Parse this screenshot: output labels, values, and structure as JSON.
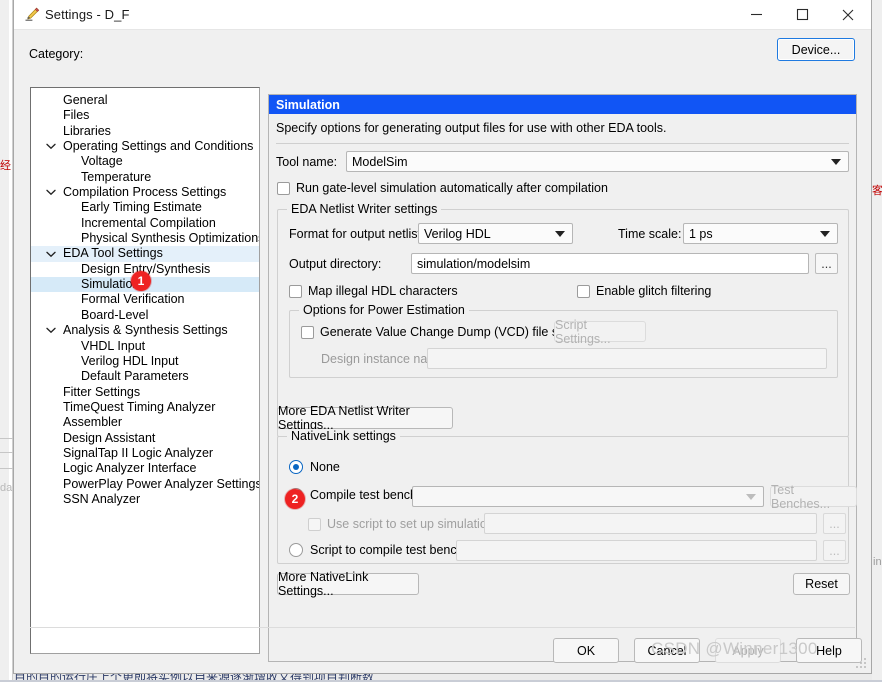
{
  "window": {
    "title": "Settings - D_F",
    "icon": "pencil-icon",
    "minimize": "minimize-icon",
    "maximize": "maximize-icon",
    "close": "close-icon"
  },
  "category": {
    "label": "Category:",
    "device_button": "Device...",
    "items": [
      {
        "label": "General",
        "level": 0,
        "expander": "none"
      },
      {
        "label": "Files",
        "level": 0,
        "expander": "none"
      },
      {
        "label": "Libraries",
        "level": 0,
        "expander": "none"
      },
      {
        "label": "Operating Settings and Conditions",
        "level": 0,
        "expander": "expanded"
      },
      {
        "label": "Voltage",
        "level": 1,
        "expander": "none"
      },
      {
        "label": "Temperature",
        "level": 1,
        "expander": "none"
      },
      {
        "label": "Compilation Process Settings",
        "level": 0,
        "expander": "expanded"
      },
      {
        "label": "Early Timing Estimate",
        "level": 1,
        "expander": "none"
      },
      {
        "label": "Incremental Compilation",
        "level": 1,
        "expander": "none"
      },
      {
        "label": "Physical Synthesis Optimizations",
        "level": 1,
        "expander": "none"
      },
      {
        "label": "EDA Tool Settings",
        "level": 0,
        "expander": "expanded",
        "state": "highlight"
      },
      {
        "label": "Design Entry/Synthesis",
        "level": 1,
        "expander": "none"
      },
      {
        "label": "Simulation",
        "level": 1,
        "expander": "none",
        "state": "selected"
      },
      {
        "label": "Formal Verification",
        "level": 1,
        "expander": "none"
      },
      {
        "label": "Board-Level",
        "level": 1,
        "expander": "none"
      },
      {
        "label": "Analysis & Synthesis Settings",
        "level": 0,
        "expander": "expanded"
      },
      {
        "label": "VHDL Input",
        "level": 1,
        "expander": "none"
      },
      {
        "label": "Verilog HDL Input",
        "level": 1,
        "expander": "none"
      },
      {
        "label": "Default Parameters",
        "level": 1,
        "expander": "none"
      },
      {
        "label": "Fitter Settings",
        "level": 0,
        "expander": "none"
      },
      {
        "label": "TimeQuest Timing Analyzer",
        "level": 0,
        "expander": "none"
      },
      {
        "label": "Assembler",
        "level": 0,
        "expander": "none"
      },
      {
        "label": "Design Assistant",
        "level": 0,
        "expander": "none"
      },
      {
        "label": "SignalTap II Logic Analyzer",
        "level": 0,
        "expander": "none"
      },
      {
        "label": "Logic Analyzer Interface",
        "level": 0,
        "expander": "none"
      },
      {
        "label": "PowerPlay Power Analyzer Settings",
        "level": 0,
        "expander": "none"
      },
      {
        "label": "SSN Analyzer",
        "level": 0,
        "expander": "none"
      }
    ]
  },
  "pane": {
    "header": "Simulation",
    "description": "Specify options for generating output files for use with other EDA tools.",
    "tool_name_label": "Tool name:",
    "tool_name_value": "ModelSim",
    "run_gate_level_label": "Run gate-level simulation automatically after compilation",
    "run_gate_level_checked": false
  },
  "netlist_writer": {
    "group_title": "EDA Netlist Writer settings",
    "format_label": "Format for output netlist:",
    "format_value": "Verilog HDL",
    "time_scale_label": "Time scale:",
    "time_scale_value": "1 ps",
    "output_dir_label": "Output directory:",
    "output_dir_value": "simulation/modelsim",
    "browse_label": "...",
    "map_illegal_label": "Map illegal HDL characters",
    "map_illegal_checked": false,
    "glitch_label": "Enable glitch filtering",
    "glitch_checked": false,
    "power_group_title": "Options for Power Estimation",
    "vcd_label": "Generate Value Change Dump (VCD) file script",
    "vcd_checked": false,
    "script_settings_button": "Script Settings...",
    "design_instance_label": "Design instance name:",
    "design_instance_value": "",
    "more_button": "More EDA Netlist Writer Settings..."
  },
  "nativelink": {
    "group_title": "NativeLink settings",
    "option_none": "None",
    "option_compile_tb": "Compile test bench:",
    "compile_tb_value": "",
    "test_benches_button": "Test Benches...",
    "use_script_label": "Use script to set up simulation:",
    "use_script_value": "",
    "use_script_checked": false,
    "option_script_tb": "Script to compile test bench:",
    "script_tb_value": "",
    "browse_label": "...",
    "selected": "None",
    "more_button": "More NativeLink Settings...",
    "reset_button": "Reset"
  },
  "footer": {
    "ok": "OK",
    "cancel": "Cancel",
    "apply": "Apply",
    "apply_enabled": false,
    "help": "Help"
  },
  "annotations": {
    "badge_1": "1",
    "badge_2": "2"
  },
  "watermark": "CSDN @Winner1300",
  "background": {
    "left_red_text": "经",
    "right_red_text": "客",
    "left_gray_text": "da",
    "right_gray_text": "in",
    "bottom_text": "目的目的运行庄上个更即将实例以自来源逐渐增收又得到项目判断数"
  },
  "colors": {
    "accent_blue": "#1155f5",
    "selection_blue": "#d6eaf8",
    "radio_blue": "#0a66c2",
    "badge_red": "#ee2222",
    "dialog_bg": "#f0f0f0"
  }
}
